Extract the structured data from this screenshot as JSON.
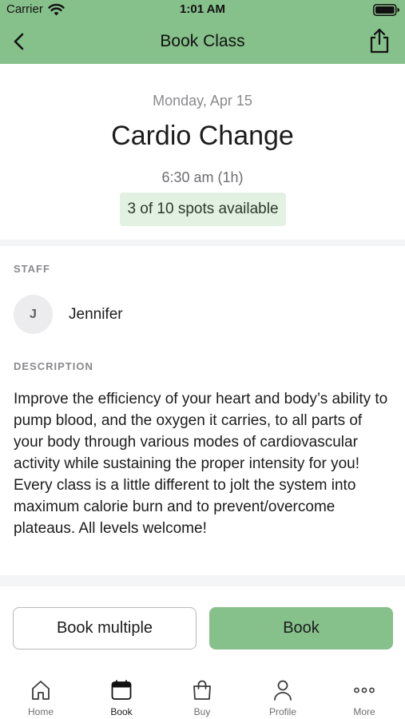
{
  "status_bar": {
    "carrier": "Carrier",
    "time": "1:01 AM"
  },
  "nav": {
    "title": "Book Class",
    "back_icon": "chevron-left-icon",
    "share_icon": "share-icon"
  },
  "class_info": {
    "date": "Monday, Apr 15",
    "title": "Cardio Change",
    "time": "6:30 am (1h)",
    "spots": "3 of 10 spots available"
  },
  "staff": {
    "label": "STAFF",
    "initial": "J",
    "name": "Jennifer"
  },
  "description": {
    "label": "DESCRIPTION",
    "text": "Improve the efficiency of your heart and body’s ability to pump blood, and the oxygen it carries, to all parts of your body through various modes of cardiovascular activity while sustaining the proper intensity for you! Every class is a little different to jolt the system into maximum calorie burn and to prevent/overcome plateaus. All levels welcome!"
  },
  "actions": {
    "book_multiple": "Book multiple",
    "book": "Book"
  },
  "tabs": [
    {
      "label": "Home",
      "icon": "home-icon",
      "active": false
    },
    {
      "label": "Book",
      "icon": "calendar-icon",
      "active": true
    },
    {
      "label": "Buy",
      "icon": "shopping-bag-icon",
      "active": false
    },
    {
      "label": "Profile",
      "icon": "person-icon",
      "active": false
    },
    {
      "label": "More",
      "icon": "more-dots-icon",
      "active": false
    }
  ],
  "colors": {
    "accent": "#86c08a",
    "badge_bg": "#e3f1e3"
  }
}
